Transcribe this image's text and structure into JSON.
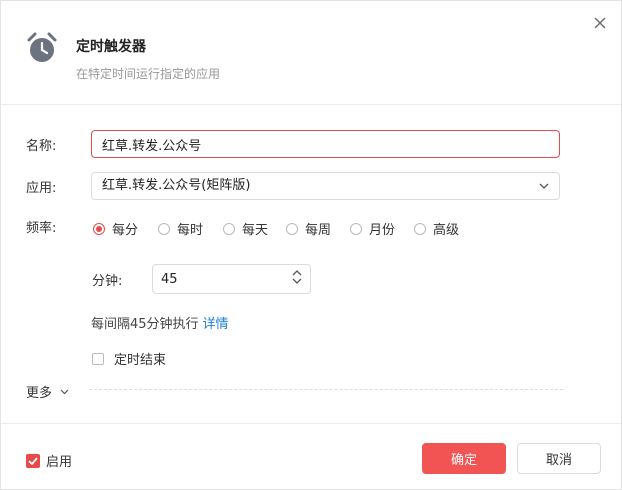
{
  "header": {
    "title": "定时触发器",
    "subtitle": "在特定时间运行指定的应用",
    "icon": "alarm-clock-icon"
  },
  "form": {
    "name_label": "名称:",
    "name_value": "红草.转发.公众号",
    "app_label": "应用:",
    "app_value": "红草.转发.公众号(矩阵版)",
    "frequency_label": "频率:",
    "frequency_options": [
      "每分",
      "每时",
      "每天",
      "每周",
      "月份",
      "高级"
    ],
    "frequency_selected": "每分",
    "minute_label": "分钟:",
    "minute_value": "45",
    "interval_desc": "每间隔45分钟执行",
    "detail_link": "详情",
    "timed_end_label": "定时结束",
    "timed_end_checked": false,
    "more_label": "更多"
  },
  "footer": {
    "enable_label": "启用",
    "enable_checked": true,
    "ok_label": "确定",
    "cancel_label": "取消"
  },
  "colors": {
    "accent": "#f25353",
    "link": "#1e7fd0"
  }
}
